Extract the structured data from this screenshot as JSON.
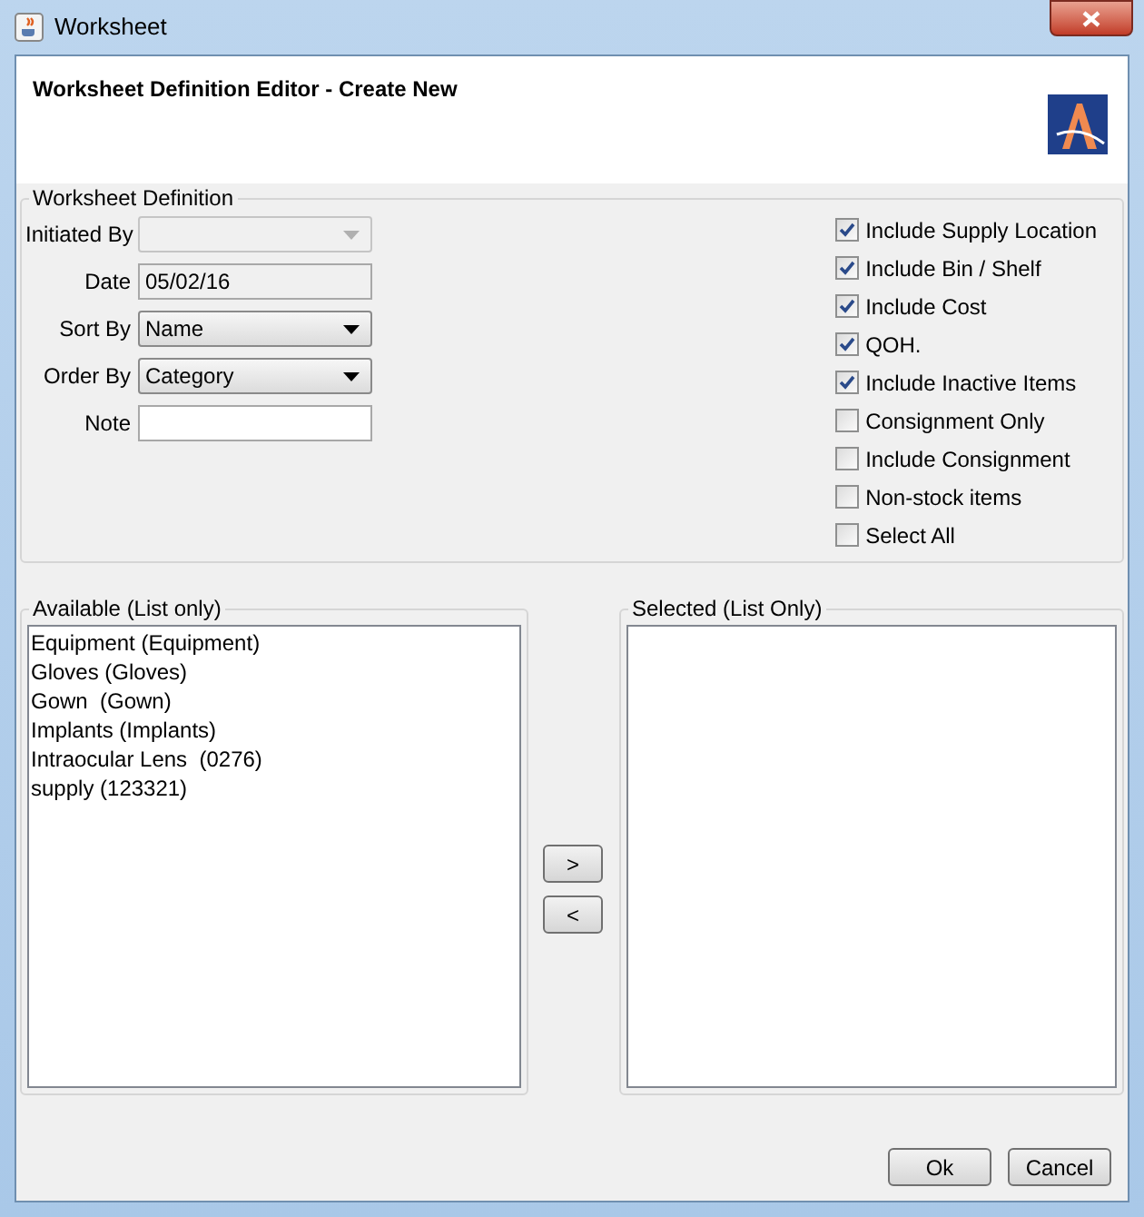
{
  "window": {
    "title": "Worksheet"
  },
  "header": {
    "title": "Worksheet Definition Editor - Create New"
  },
  "definition": {
    "legend": "Worksheet Definition",
    "fields": [
      {
        "kind": "combo",
        "label": "Initiated By",
        "disabled": true
      },
      {
        "kind": "text",
        "label": "Date",
        "value": "05/02/16",
        "disabled": true
      },
      {
        "kind": "combo",
        "label": "Sort By",
        "value": "Name",
        "disabled": false
      },
      {
        "kind": "combo",
        "label": "Order By",
        "value": "Category",
        "disabled": false
      },
      {
        "kind": "text",
        "label": "Note",
        "disabled": false
      }
    ],
    "options": [
      {
        "label": "Include Supply Location",
        "checked": true
      },
      {
        "label": "Include Bin / Shelf",
        "checked": true
      },
      {
        "label": "Include Cost",
        "checked": true
      },
      {
        "label": "QOH.",
        "checked": true
      },
      {
        "label": "Include Inactive Items",
        "checked": true
      },
      {
        "label": "Consignment Only",
        "checked": false
      },
      {
        "label": "Include Consignment",
        "checked": false
      },
      {
        "label": "Non-stock items",
        "checked": false
      },
      {
        "label": "Select All",
        "checked": false
      }
    ]
  },
  "available": {
    "legend": "Available (List only)",
    "items": [
      "Equipment (Equipment)",
      "Gloves (Gloves)",
      "Gown  (Gown)",
      "Implants (Implants)",
      "Intraocular Lens  (0276)",
      "supply (123321)"
    ]
  },
  "selected": {
    "legend": "Selected (List Only)"
  },
  "transfer_buttons": [
    ">",
    "<"
  ],
  "buttons": [
    "Ok",
    "Cancel"
  ]
}
